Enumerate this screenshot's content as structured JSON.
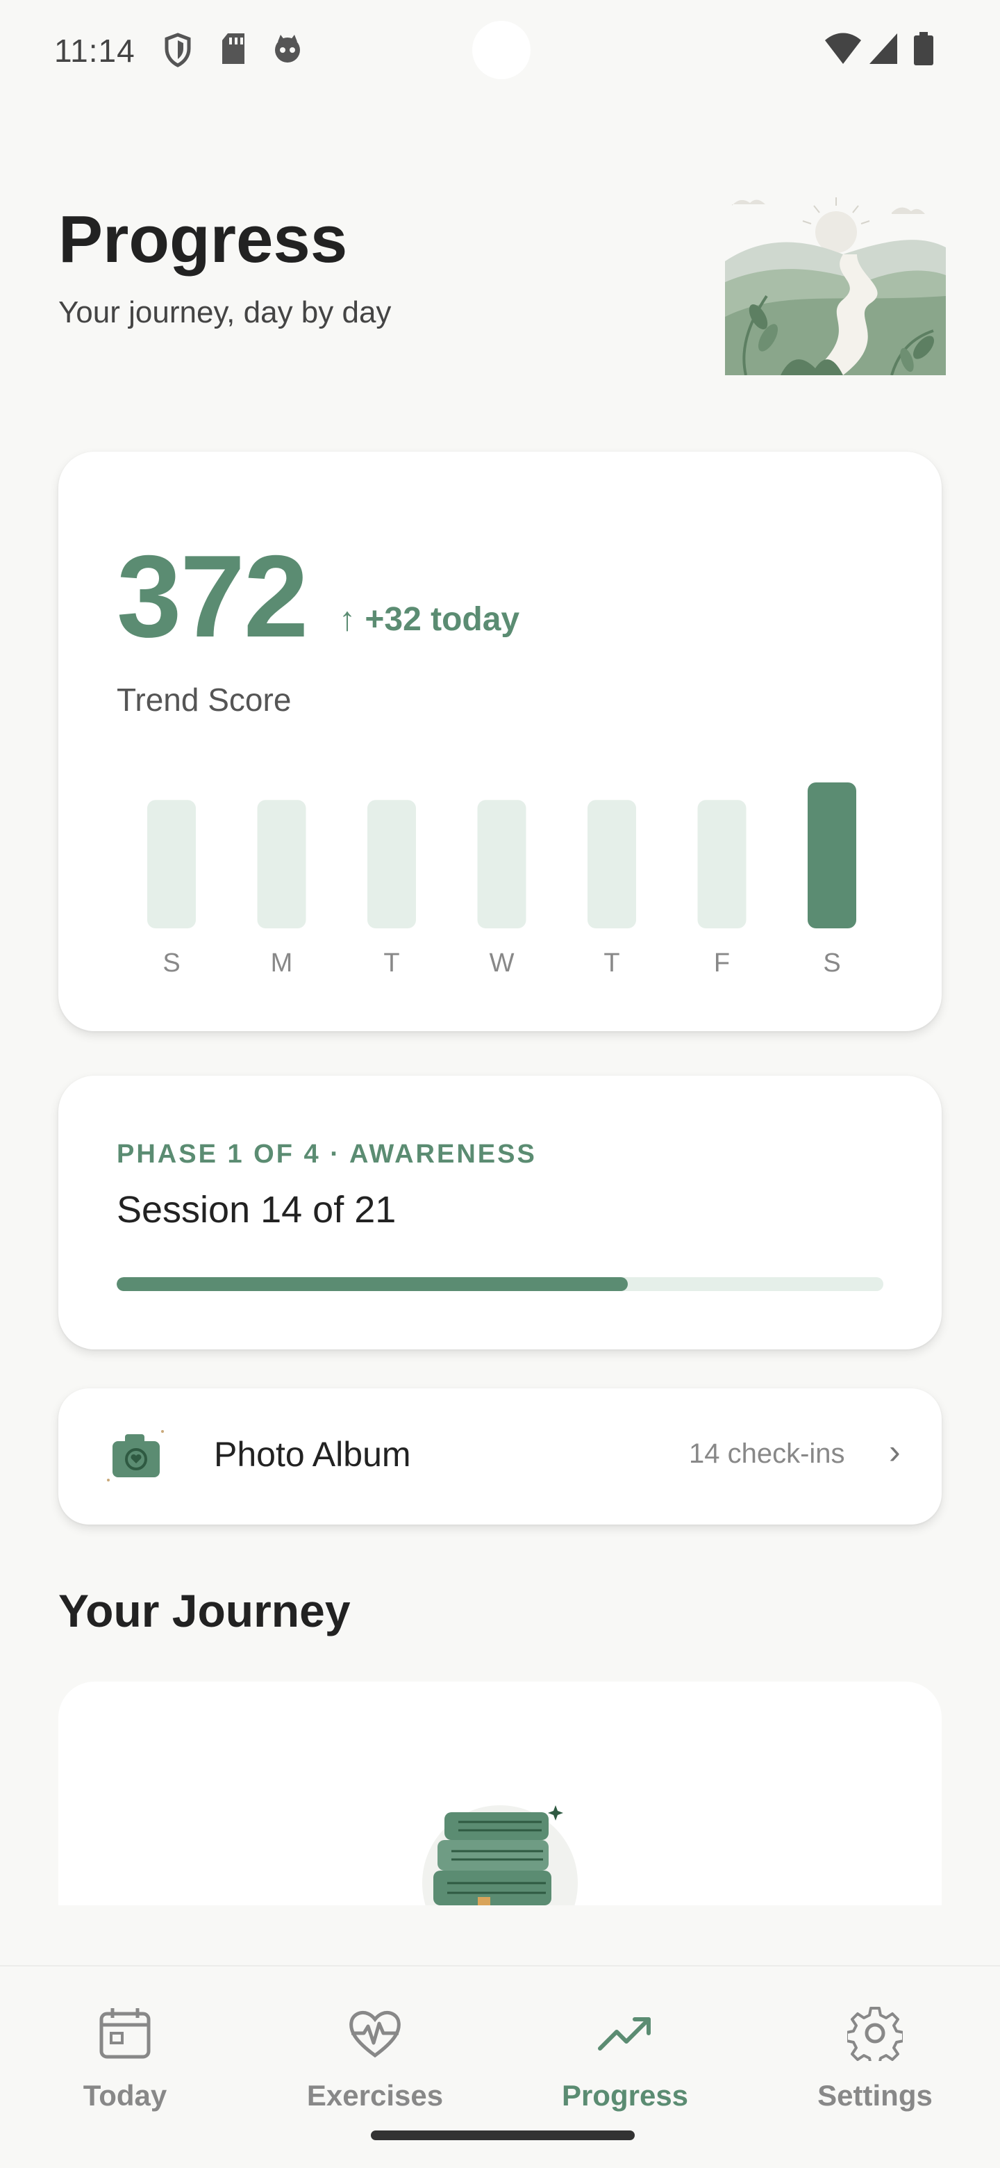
{
  "status_bar": {
    "time": "11:14",
    "icons": [
      "shield-icon",
      "sd-card-icon",
      "face-icon",
      "wifi-icon",
      "signal-icon",
      "battery-icon"
    ]
  },
  "header": {
    "title": "Progress",
    "subtitle": "Your journey, day by day"
  },
  "score_card": {
    "value": "372",
    "delta": "↑ +32 today",
    "label": "Trend Score",
    "colors": {
      "accent": "#5b8c72",
      "muted_bar": "#e5efe9"
    }
  },
  "chart_data": {
    "type": "bar",
    "categories": [
      "S",
      "M",
      "T",
      "W",
      "T",
      "F",
      "S"
    ],
    "values": [
      0.88,
      0.88,
      0.88,
      0.88,
      0.88,
      0.88,
      1.0
    ],
    "highlight_index": 6,
    "grid": false
  },
  "phase_card": {
    "phase_label": "PHASE 1 OF 4 · AWARENESS",
    "session_label": "Session 14 of 21",
    "progress": 0.667
  },
  "album": {
    "title": "Photo Album",
    "count": "14 check-ins",
    "icon": "camera-icon",
    "chevron": "›"
  },
  "journey": {
    "title": "Your Journey"
  },
  "nav": {
    "items": [
      {
        "label": "Today",
        "icon": "calendar-icon"
      },
      {
        "label": "Exercises",
        "icon": "heart-pulse-icon"
      },
      {
        "label": "Progress",
        "icon": "trending-up-icon"
      },
      {
        "label": "Settings",
        "icon": "gear-icon"
      }
    ],
    "active_index": 2
  }
}
